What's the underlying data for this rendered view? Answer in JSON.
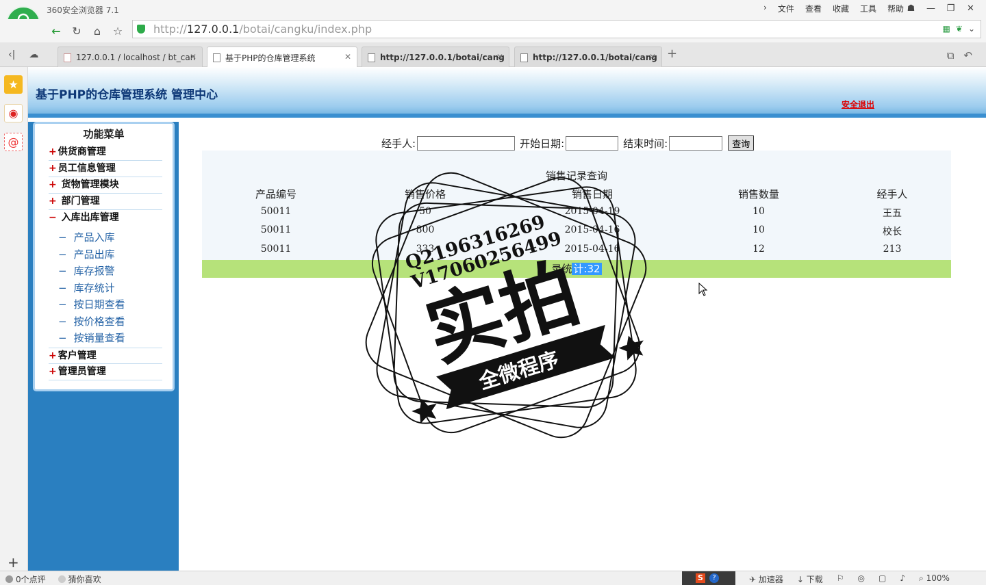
{
  "browser": {
    "app_title": "360安全浏览器 7.1",
    "menu": [
      "文件",
      "查看",
      "收藏",
      "工具",
      "帮助"
    ],
    "url_scheme": "http://",
    "url_host": "127.0.0.1",
    "url_path": "/botai/cangku/index.php",
    "tabs": [
      {
        "title": "127.0.0.1 / localhost / bt_can"
      },
      {
        "title": "基于PHP的仓库管理系统"
      },
      {
        "title": "http://127.0.0.1/botai/cang"
      },
      {
        "title": "http://127.0.0.1/botai/cang"
      }
    ]
  },
  "header": {
    "site_title": "基于PHP的仓库管理系统 管理中心",
    "logout": "安全退出"
  },
  "sidebar": {
    "title": "功能菜单",
    "items": [
      {
        "marker": "+",
        "label": "供货商管理"
      },
      {
        "marker": "+",
        "label": "员工信息管理"
      },
      {
        "marker": "+",
        "label": " 货物管理模块"
      },
      {
        "marker": "+",
        "label": " 部门管理"
      },
      {
        "marker": "−",
        "label": " 入库出库管理"
      }
    ],
    "sub_items": [
      "产品入库",
      "产品出库",
      "库存报警",
      "库存统计",
      "按日期查看",
      "按价格查看",
      "按销量查看"
    ],
    "bottom_items": [
      {
        "marker": "+",
        "label": "客户管理"
      },
      {
        "marker": "+",
        "label": "管理员管理"
      }
    ]
  },
  "search": {
    "handler_label": "经手人:",
    "start_label": "开始日期:",
    "end_label": "结束时间:",
    "button": "查询"
  },
  "table": {
    "caption": "销售记录查询",
    "headers": [
      "产品编号",
      "销售价格",
      "销售日期",
      "销售数量",
      "经手人"
    ],
    "rows": [
      [
        "50011",
        "50",
        "2015-04-19",
        "10",
        "王五"
      ],
      [
        "50011",
        "800",
        "2015-04-16",
        "10",
        "校长"
      ],
      [
        "50011",
        "333",
        "2015-04-16",
        "12",
        "213"
      ]
    ],
    "footer_text": "录统",
    "footer_highlight": "计:32"
  },
  "watermark": {
    "line1": "Q2196316269",
    "line2": "V17060256499",
    "main": "实拍",
    "banner": "全微程序"
  },
  "statusbar": {
    "comments": "0个点评",
    "guess": "猜你喜欢",
    "accelerator": "加速器",
    "download": "下载",
    "zoom": "100%"
  }
}
